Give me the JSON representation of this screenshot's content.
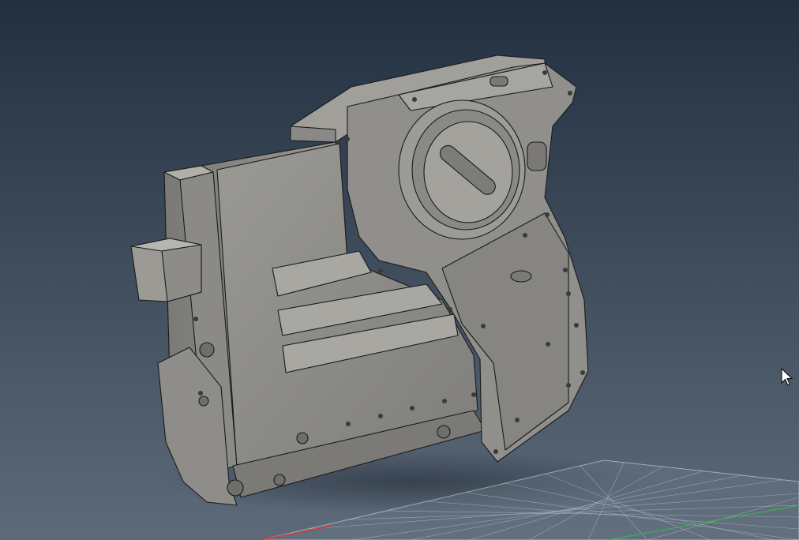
{
  "viewport": {
    "background_top": "#233041",
    "background_bottom": "#5d6a79",
    "model_fill": "#8d8c88",
    "model_shadow": "#5f5e5b",
    "model_highlight": "#b3b2ad",
    "edge_color": "#1a1a1a",
    "grid_color": "#c8d0da",
    "grid_x_axis_color": "#d03a3a",
    "grid_y_axis_color": "#37b34a"
  },
  "icons": {
    "cursor": "mouse-pointer-icon"
  }
}
